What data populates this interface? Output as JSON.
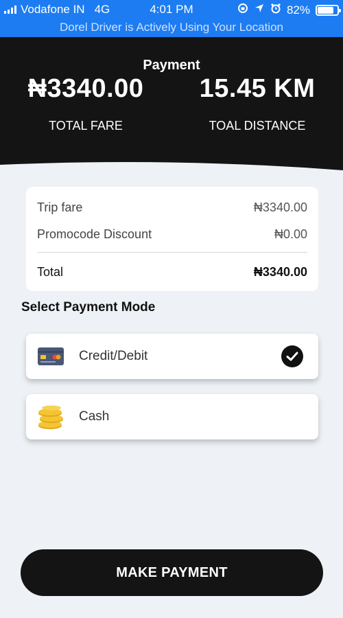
{
  "status_bar": {
    "carrier": "Vodafone IN",
    "network": "4G",
    "time": "4:01 PM",
    "battery": "82%",
    "battery_level": 0.82
  },
  "location_banner": "Dorel Driver is Actively Using Your Location",
  "header": {
    "title": "Payment",
    "total_fare_value": "₦3340.00",
    "total_fare_label": "TOTAL FARE",
    "total_distance_value": "15.45 KM",
    "total_distance_label": "TOAL DISTANCE"
  },
  "summary": {
    "trip_fare_label": "Trip fare",
    "trip_fare_amount": "₦3340.00",
    "promo_label": "Promocode Discount",
    "promo_amount": "₦0.00",
    "total_label": "Total",
    "total_amount": "₦3340.00"
  },
  "payment": {
    "section_title": "Select Payment Mode",
    "options": [
      {
        "label": "Credit/Debit",
        "icon": "credit-card-icon",
        "selected": true
      },
      {
        "label": "Cash",
        "icon": "coins-icon",
        "selected": false
      }
    ],
    "button_label": "MAKE PAYMENT"
  },
  "colors": {
    "status_bar": "#1d7cf2",
    "header_bg": "#141414",
    "page_bg": "#eef1f6"
  }
}
